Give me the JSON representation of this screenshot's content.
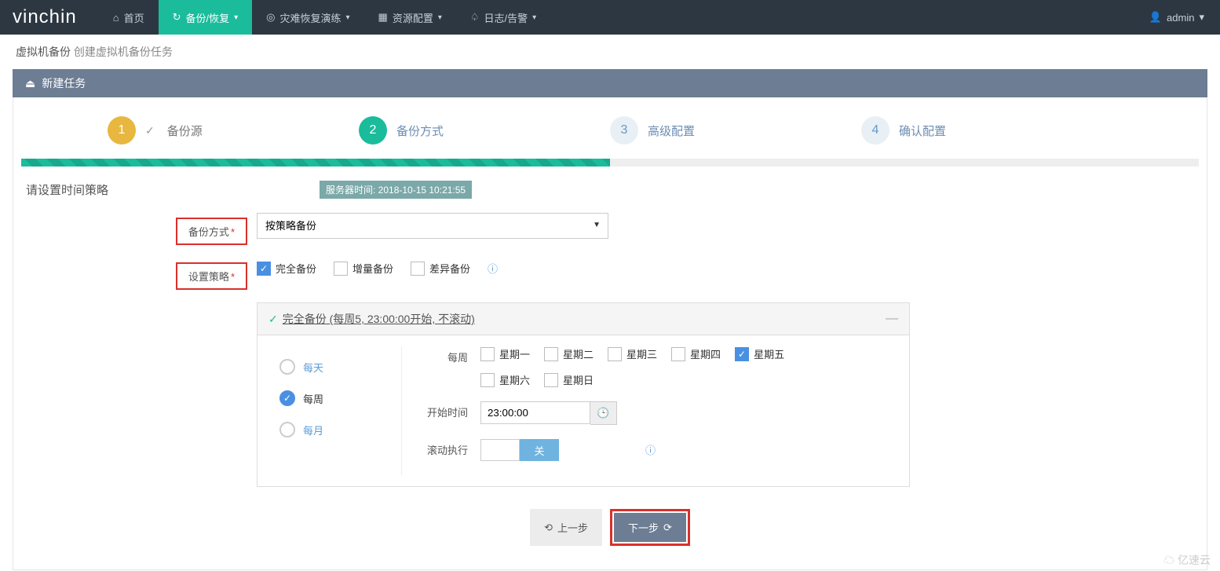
{
  "brand": "vinchin",
  "nav": {
    "home": "首页",
    "backup": "备份/恢复",
    "dr": "灾难恢复演练",
    "resource": "资源配置",
    "log": "日志/告警"
  },
  "user": "admin",
  "breadcrumb": {
    "main": "虚拟机备份",
    "sub": "创建虚拟机备份任务"
  },
  "panel_title": "新建任务",
  "wizard": {
    "s1": "备份源",
    "s2": "备份方式",
    "s3": "高级配置",
    "s4": "确认配置"
  },
  "form": {
    "section_title": "请设置时间策略",
    "server_time": "服务器时间: 2018-10-15 10:21:55",
    "mode_label": "备份方式",
    "mode_value": "按策略备份",
    "policy_label": "设置策略",
    "full": "完全备份",
    "incr": "增量备份",
    "diff": "差异备份"
  },
  "policy": {
    "summary": "完全备份 (每周5, 23:00:00开始, 不滚动)",
    "freq_daily": "每天",
    "freq_weekly": "每周",
    "freq_monthly": "每月",
    "weekly_label": "每周",
    "days": {
      "mon": "星期一",
      "tue": "星期二",
      "wed": "星期三",
      "thu": "星期四",
      "fri": "星期五",
      "sat": "星期六",
      "sun": "星期日"
    },
    "start_label": "开始时间",
    "start_value": "23:00:00",
    "roll_label": "滚动执行",
    "roll_off": "关"
  },
  "buttons": {
    "prev": "上一步",
    "next": "下一步"
  },
  "watermark": "亿速云"
}
